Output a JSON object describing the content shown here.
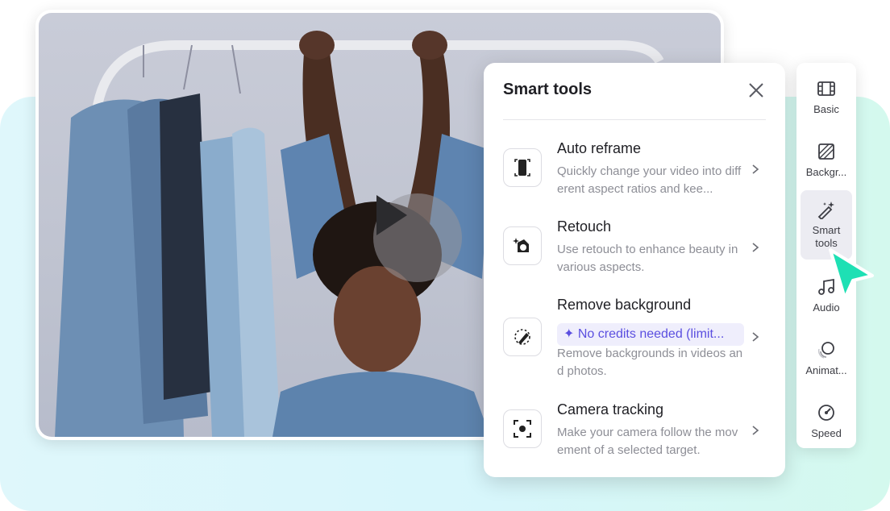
{
  "panel": {
    "title": "Smart tools",
    "tools": [
      {
        "name": "Auto reframe",
        "description": "Quickly change your video into different aspect ratios and kee...",
        "icon": "auto-reframe-icon"
      },
      {
        "name": "Retouch",
        "description": "Use retouch to enhance beauty in various aspects.",
        "icon": "retouch-icon"
      },
      {
        "name": "Remove background",
        "badge": "✦ No credits needed (limit...",
        "description": "Remove backgrounds in videos and photos.",
        "icon": "remove-background-icon"
      },
      {
        "name": "Camera tracking",
        "description": "Make your camera follow the movement of a selected target.",
        "icon": "camera-tracking-icon"
      }
    ]
  },
  "sidebar": {
    "items": [
      {
        "label": "Basic",
        "icon": "film-icon"
      },
      {
        "label": "Backgr...",
        "icon": "background-icon"
      },
      {
        "label": "Smart tools",
        "icon": "magic-wand-icon",
        "active": true
      },
      {
        "label": "Audio",
        "icon": "music-note-icon"
      },
      {
        "label": "Animat...",
        "icon": "animation-icon"
      },
      {
        "label": "Speed",
        "icon": "speed-icon"
      }
    ]
  },
  "colors": {
    "accent": "#5b4fe0",
    "cursor": "#1ee0b4",
    "badge_bg": "#efeefc"
  }
}
